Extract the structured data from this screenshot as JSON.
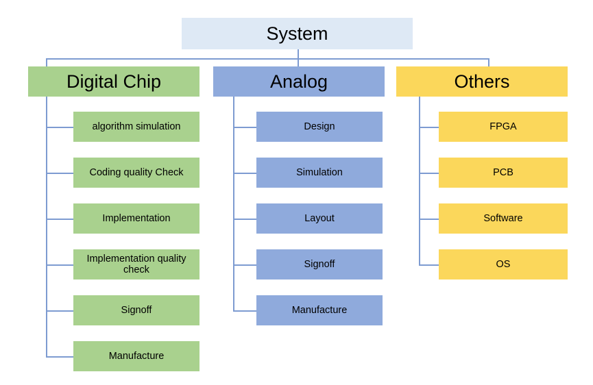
{
  "diagram": {
    "title": "System",
    "type": "organization-tree",
    "root": {
      "label": "System",
      "color": "#DEE9F5"
    },
    "connector_color": "#7D9BD1",
    "background": "#FFFFFF",
    "branches": [
      {
        "label": "Digital Chip",
        "color": "#A9D18E",
        "children": [
          {
            "label": "algorithm simulation"
          },
          {
            "label": "Coding quality Check"
          },
          {
            "label": "Implementation"
          },
          {
            "label": "Implementation quality check"
          },
          {
            "label": "Signoff"
          },
          {
            "label": "Manufacture"
          }
        ]
      },
      {
        "label": "Analog",
        "color": "#8FAADC",
        "children": [
          {
            "label": "Design"
          },
          {
            "label": "Simulation"
          },
          {
            "label": "Layout"
          },
          {
            "label": "Signoff"
          },
          {
            "label": "Manufacture"
          }
        ]
      },
      {
        "label": "Others",
        "color": "#FBD75B",
        "children": [
          {
            "label": "FPGA"
          },
          {
            "label": "PCB"
          },
          {
            "label": "Software"
          },
          {
            "label": "OS"
          }
        ]
      }
    ]
  }
}
